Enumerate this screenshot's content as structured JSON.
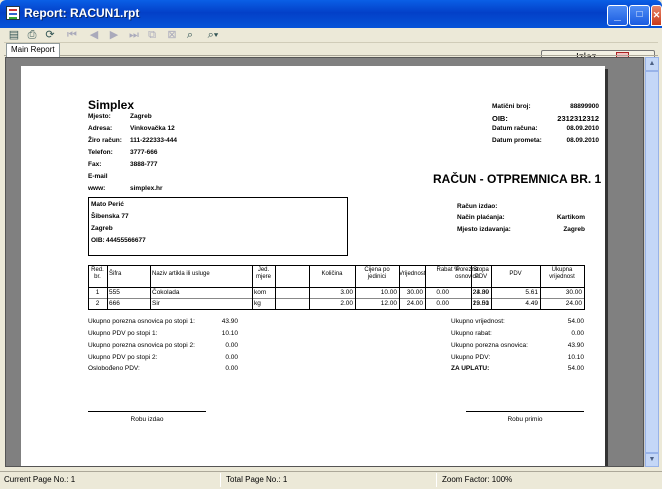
{
  "window": {
    "title": "Report: RACUN1.rpt",
    "minimize": "_",
    "maximize": "□",
    "close": "✕"
  },
  "toolbar": {
    "exit_label": "Izlaz"
  },
  "tabs": [
    {
      "label": "Main Report"
    }
  ],
  "report": {
    "company": "Simplex",
    "company_fields": [
      {
        "label": "Mjesto:",
        "value": "Zagreb"
      },
      {
        "label": "Adresa:",
        "value": "Vinkovačka 12"
      },
      {
        "label": "Žiro račun:",
        "value": "111-222333-444"
      },
      {
        "label": "Telefon:",
        "value": "3777-666"
      },
      {
        "label": "Fax:",
        "value": "3888-777"
      },
      {
        "label": "E-mail",
        "value": ""
      },
      {
        "label": "www:",
        "value": "simplex.hr"
      }
    ],
    "right_fields": [
      {
        "label": "Matični broj:",
        "value": "88899900"
      },
      {
        "label": "OIB:",
        "value": "2312312312"
      },
      {
        "label": "Datum računa:",
        "value": "08.09.2010"
      },
      {
        "label": "Datum prometa:",
        "value": "08.09.2010"
      }
    ],
    "doc_title": "RAČUN - OTPREMNICA BR. 1",
    "customer": {
      "name": "Mato Perić",
      "address": "Šibenska 77",
      "city": "Zagreb",
      "oib_label": "OIB:",
      "oib": "44455566677"
    },
    "invoice_fields": [
      {
        "label": "Račun izdao:",
        "value": ""
      },
      {
        "label": "Način plaćanja:",
        "value": "Kartikom"
      },
      {
        "label": "Mjesto izdavanja:",
        "value": "Zagreb"
      }
    ],
    "table": {
      "headers": [
        "Red. br.",
        "Šifra",
        "Naziv artikla ili usluge",
        "Jed. mjere",
        "Količina",
        "Cijena po jedinici",
        "Vrijednost",
        "Rabat %",
        "Porezna osnovica",
        "Stopa PDV",
        "PDV",
        "Ukupna vrijednost"
      ],
      "rows": [
        [
          "1",
          "555",
          "Čokolada",
          "kom",
          "3.00",
          "10.00",
          "30.00",
          "0.00",
          "24.39",
          "23.00",
          "5.61",
          "30.00"
        ],
        [
          "2",
          "666",
          "Sir",
          "kg",
          "2.00",
          "12.00",
          "24.00",
          "0.00",
          "19.51",
          "23.00",
          "4.49",
          "24.00"
        ]
      ]
    },
    "left_summary": [
      {
        "label": "Ukupno porezna osnovica po stopi 1:",
        "value": "43.90"
      },
      {
        "label": "Ukupno PDV po stopi 1:",
        "value": "10.10"
      },
      {
        "label": "Ukupno porezna osnovica po stopi 2:",
        "value": "0.00"
      },
      {
        "label": "Ukupno PDV po stopi 2:",
        "value": "0.00"
      },
      {
        "label": "Oslobođeno PDV:",
        "value": "0.00"
      }
    ],
    "right_summary": [
      {
        "label": "Ukupno vrijednost:",
        "value": "54.00"
      },
      {
        "label": "Ukupno rabat:",
        "value": "0.00"
      },
      {
        "label": "Ukupno porezna osnovica:",
        "value": "43.90"
      },
      {
        "label": "Ukupno PDV:",
        "value": "10.10"
      },
      {
        "label": "ZA UPLATU:",
        "value": "54.00"
      }
    ],
    "sign_left": "Robu izdao",
    "sign_right": "Robu primio"
  },
  "status": {
    "current_page": "Current Page No.: 1",
    "total_page": "Total Page No.: 1",
    "zoom": "Zoom Factor: 100%"
  }
}
